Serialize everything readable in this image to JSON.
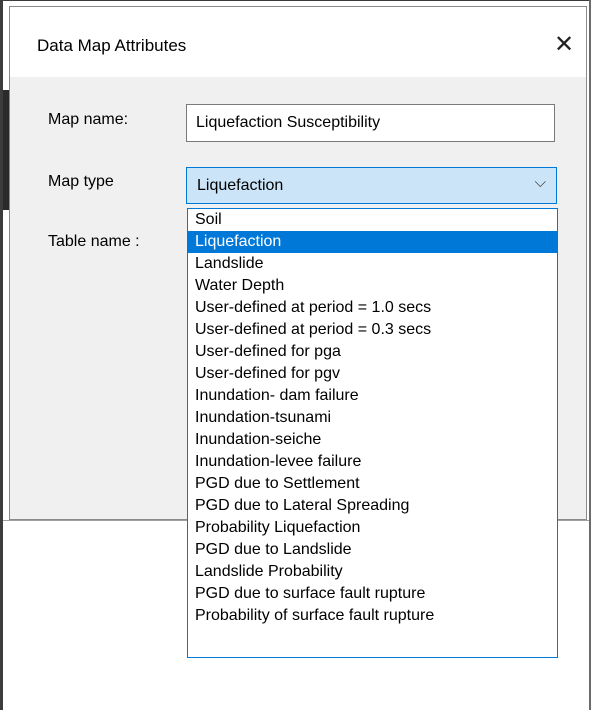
{
  "dialog": {
    "title": "Data Map Attributes",
    "close_glyph": "✕"
  },
  "form": {
    "map_name_label": "Map name:",
    "map_name_value": "Liquefaction Susceptibility",
    "map_type_label": "Map type",
    "map_type_value": "Liquefaction",
    "table_name_label": "Table name :"
  },
  "dropdown": {
    "chevron_glyph": "⌵",
    "selected_index": 1,
    "options": [
      "Soil",
      "Liquefaction",
      "Landslide",
      "Water Depth",
      "User-defined at period = 1.0 secs",
      "User-defined at period = 0.3 secs",
      "User-defined for pga",
      "User-defined for pgv",
      "Inundation- dam failure",
      "Inundation-tsunami",
      "Inundation-seiche",
      "Inundation-levee failure",
      "PGD due to Settlement",
      "PGD due to Lateral Spreading",
      "Probability Liquefaction",
      "PGD due to Landslide",
      "Landslide Probability",
      "PGD due to surface fault rupture",
      "Probability of surface fault rupture"
    ]
  },
  "colors": {
    "accent": "#0078d7",
    "combo_bg": "#cce4f7",
    "dialog_bg": "#f0f0f0"
  }
}
